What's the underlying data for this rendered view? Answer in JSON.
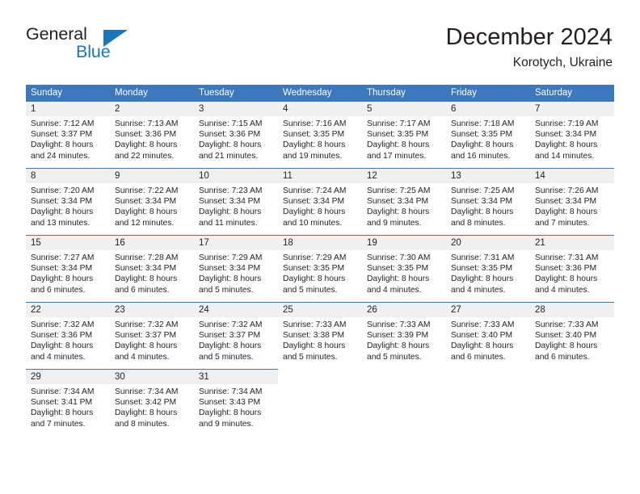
{
  "brand": {
    "word_one": "General",
    "word_two": "Blue",
    "triangle_icon": "blue-triangle-icon",
    "accent_color": "#1b75bb"
  },
  "header": {
    "title": "December 2024",
    "subtitle": "Korotych, Ukraine"
  },
  "theme": {
    "header_blue": "#3c78be",
    "day_band_gray": "#f0f0f0",
    "text_color": "#231f20"
  },
  "weekday_headers": [
    "Sunday",
    "Monday",
    "Tuesday",
    "Wednesday",
    "Thursday",
    "Friday",
    "Saturday"
  ],
  "weeks": [
    [
      {
        "day": "1",
        "sunrise": "Sunrise: 7:12 AM",
        "sunset": "Sunset: 3:37 PM",
        "daylight_line1": "Daylight: 8 hours",
        "daylight_line2": "and 24 minutes."
      },
      {
        "day": "2",
        "sunrise": "Sunrise: 7:13 AM",
        "sunset": "Sunset: 3:36 PM",
        "daylight_line1": "Daylight: 8 hours",
        "daylight_line2": "and 22 minutes."
      },
      {
        "day": "3",
        "sunrise": "Sunrise: 7:15 AM",
        "sunset": "Sunset: 3:36 PM",
        "daylight_line1": "Daylight: 8 hours",
        "daylight_line2": "and 21 minutes."
      },
      {
        "day": "4",
        "sunrise": "Sunrise: 7:16 AM",
        "sunset": "Sunset: 3:35 PM",
        "daylight_line1": "Daylight: 8 hours",
        "daylight_line2": "and 19 minutes."
      },
      {
        "day": "5",
        "sunrise": "Sunrise: 7:17 AM",
        "sunset": "Sunset: 3:35 PM",
        "daylight_line1": "Daylight: 8 hours",
        "daylight_line2": "and 17 minutes."
      },
      {
        "day": "6",
        "sunrise": "Sunrise: 7:18 AM",
        "sunset": "Sunset: 3:35 PM",
        "daylight_line1": "Daylight: 8 hours",
        "daylight_line2": "and 16 minutes."
      },
      {
        "day": "7",
        "sunrise": "Sunrise: 7:19 AM",
        "sunset": "Sunset: 3:34 PM",
        "daylight_line1": "Daylight: 8 hours",
        "daylight_line2": "and 14 minutes."
      }
    ],
    [
      {
        "day": "8",
        "sunrise": "Sunrise: 7:20 AM",
        "sunset": "Sunset: 3:34 PM",
        "daylight_line1": "Daylight: 8 hours",
        "daylight_line2": "and 13 minutes."
      },
      {
        "day": "9",
        "sunrise": "Sunrise: 7:22 AM",
        "sunset": "Sunset: 3:34 PM",
        "daylight_line1": "Daylight: 8 hours",
        "daylight_line2": "and 12 minutes."
      },
      {
        "day": "10",
        "sunrise": "Sunrise: 7:23 AM",
        "sunset": "Sunset: 3:34 PM",
        "daylight_line1": "Daylight: 8 hours",
        "daylight_line2": "and 11 minutes."
      },
      {
        "day": "11",
        "sunrise": "Sunrise: 7:24 AM",
        "sunset": "Sunset: 3:34 PM",
        "daylight_line1": "Daylight: 8 hours",
        "daylight_line2": "and 10 minutes."
      },
      {
        "day": "12",
        "sunrise": "Sunrise: 7:25 AM",
        "sunset": "Sunset: 3:34 PM",
        "daylight_line1": "Daylight: 8 hours",
        "daylight_line2": "and 9 minutes."
      },
      {
        "day": "13",
        "sunrise": "Sunrise: 7:25 AM",
        "sunset": "Sunset: 3:34 PM",
        "daylight_line1": "Daylight: 8 hours",
        "daylight_line2": "and 8 minutes."
      },
      {
        "day": "14",
        "sunrise": "Sunrise: 7:26 AM",
        "sunset": "Sunset: 3:34 PM",
        "daylight_line1": "Daylight: 8 hours",
        "daylight_line2": "and 7 minutes."
      }
    ],
    [
      {
        "day": "15",
        "sunrise": "Sunrise: 7:27 AM",
        "sunset": "Sunset: 3:34 PM",
        "daylight_line1": "Daylight: 8 hours",
        "daylight_line2": "and 6 minutes."
      },
      {
        "day": "16",
        "sunrise": "Sunrise: 7:28 AM",
        "sunset": "Sunset: 3:34 PM",
        "daylight_line1": "Daylight: 8 hours",
        "daylight_line2": "and 6 minutes."
      },
      {
        "day": "17",
        "sunrise": "Sunrise: 7:29 AM",
        "sunset": "Sunset: 3:34 PM",
        "daylight_line1": "Daylight: 8 hours",
        "daylight_line2": "and 5 minutes."
      },
      {
        "day": "18",
        "sunrise": "Sunrise: 7:29 AM",
        "sunset": "Sunset: 3:35 PM",
        "daylight_line1": "Daylight: 8 hours",
        "daylight_line2": "and 5 minutes."
      },
      {
        "day": "19",
        "sunrise": "Sunrise: 7:30 AM",
        "sunset": "Sunset: 3:35 PM",
        "daylight_line1": "Daylight: 8 hours",
        "daylight_line2": "and 4 minutes."
      },
      {
        "day": "20",
        "sunrise": "Sunrise: 7:31 AM",
        "sunset": "Sunset: 3:35 PM",
        "daylight_line1": "Daylight: 8 hours",
        "daylight_line2": "and 4 minutes."
      },
      {
        "day": "21",
        "sunrise": "Sunrise: 7:31 AM",
        "sunset": "Sunset: 3:36 PM",
        "daylight_line1": "Daylight: 8 hours",
        "daylight_line2": "and 4 minutes."
      }
    ],
    [
      {
        "day": "22",
        "sunrise": "Sunrise: 7:32 AM",
        "sunset": "Sunset: 3:36 PM",
        "daylight_line1": "Daylight: 8 hours",
        "daylight_line2": "and 4 minutes."
      },
      {
        "day": "23",
        "sunrise": "Sunrise: 7:32 AM",
        "sunset": "Sunset: 3:37 PM",
        "daylight_line1": "Daylight: 8 hours",
        "daylight_line2": "and 4 minutes."
      },
      {
        "day": "24",
        "sunrise": "Sunrise: 7:32 AM",
        "sunset": "Sunset: 3:37 PM",
        "daylight_line1": "Daylight: 8 hours",
        "daylight_line2": "and 5 minutes."
      },
      {
        "day": "25",
        "sunrise": "Sunrise: 7:33 AM",
        "sunset": "Sunset: 3:38 PM",
        "daylight_line1": "Daylight: 8 hours",
        "daylight_line2": "and 5 minutes."
      },
      {
        "day": "26",
        "sunrise": "Sunrise: 7:33 AM",
        "sunset": "Sunset: 3:39 PM",
        "daylight_line1": "Daylight: 8 hours",
        "daylight_line2": "and 5 minutes."
      },
      {
        "day": "27",
        "sunrise": "Sunrise: 7:33 AM",
        "sunset": "Sunset: 3:40 PM",
        "daylight_line1": "Daylight: 8 hours",
        "daylight_line2": "and 6 minutes."
      },
      {
        "day": "28",
        "sunrise": "Sunrise: 7:33 AM",
        "sunset": "Sunset: 3:40 PM",
        "daylight_line1": "Daylight: 8 hours",
        "daylight_line2": "and 6 minutes."
      }
    ],
    [
      {
        "day": "29",
        "sunrise": "Sunrise: 7:34 AM",
        "sunset": "Sunset: 3:41 PM",
        "daylight_line1": "Daylight: 8 hours",
        "daylight_line2": "and 7 minutes."
      },
      {
        "day": "30",
        "sunrise": "Sunrise: 7:34 AM",
        "sunset": "Sunset: 3:42 PM",
        "daylight_line1": "Daylight: 8 hours",
        "daylight_line2": "and 8 minutes."
      },
      {
        "day": "31",
        "sunrise": "Sunrise: 7:34 AM",
        "sunset": "Sunset: 3:43 PM",
        "daylight_line1": "Daylight: 8 hours",
        "daylight_line2": "and 9 minutes."
      },
      null,
      null,
      null,
      null
    ]
  ]
}
